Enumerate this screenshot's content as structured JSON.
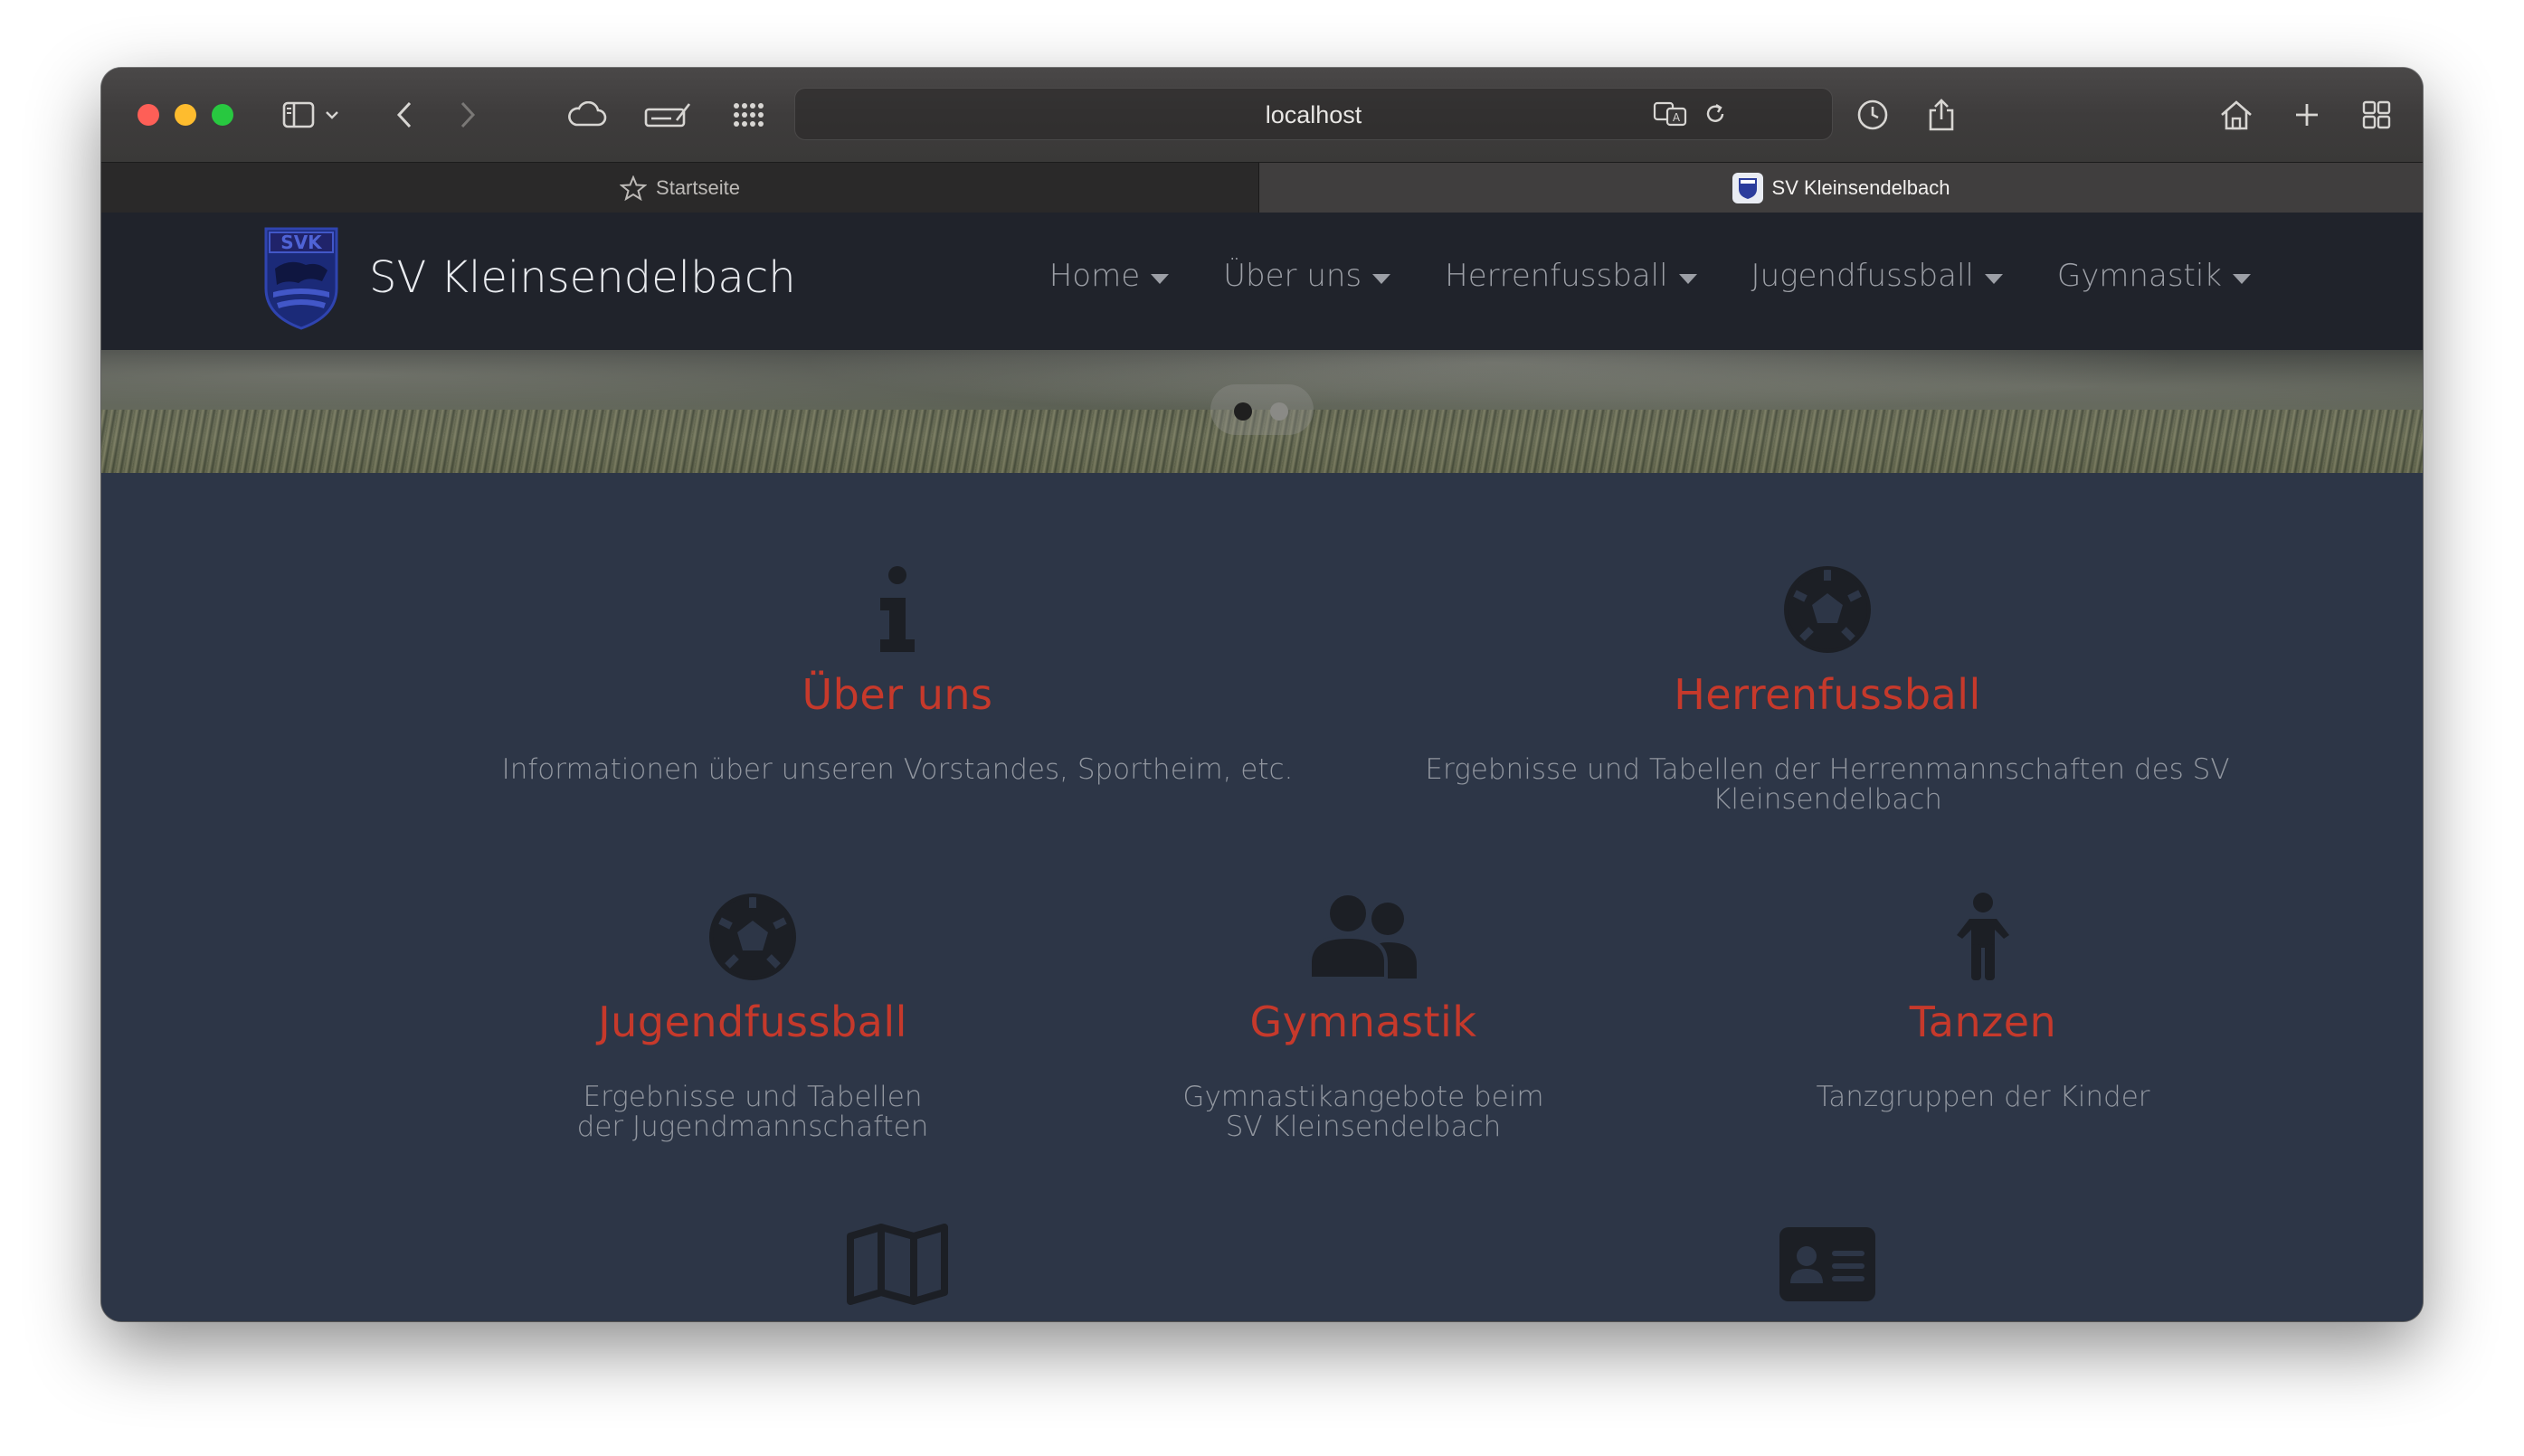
{
  "browser": {
    "url": "localhost",
    "tabs": [
      {
        "label": "Startseite",
        "active": false
      },
      {
        "label": "SV Kleinsendelbach",
        "active": true
      }
    ]
  },
  "site": {
    "brand": "SV Kleinsendelbach",
    "logo_text": "SVK",
    "nav": [
      {
        "label": "Home"
      },
      {
        "label": "Über uns"
      },
      {
        "label": "Herrenfussball"
      },
      {
        "label": "Jugendfussball"
      },
      {
        "label": "Gymnastik"
      }
    ]
  },
  "carousel": {
    "slides": 2,
    "active": 1
  },
  "features": [
    {
      "icon": "info-icon",
      "title": "Über uns",
      "text": "Informationen über unseren Vorstandes, Sportheim, etc."
    },
    {
      "icon": "soccer-ball-icon",
      "title": "Herrenfussball",
      "text": "Ergebnisse und Tabellen der Herrenmannschaften des SV Kleinsendelbach"
    },
    {
      "icon": "soccer-ball-icon",
      "title": "Jugendfussball",
      "text": "Ergebnisse und Tabellen der Jugendmannschaften"
    },
    {
      "icon": "users-icon",
      "title": "Gymnastik",
      "text": "Gymnastikangebote beim SV Kleinsendelbach"
    },
    {
      "icon": "child-icon",
      "title": "Tanzen",
      "text": "Tanzgruppen der Kinder"
    },
    {
      "icon": "map-icon",
      "title": "",
      "text": ""
    },
    {
      "icon": "id-card-icon",
      "title": "",
      "text": ""
    }
  ],
  "colors": {
    "accent": "#c6392b",
    "content_bg": "#2d3647",
    "nav_bg": "#20232b",
    "icon": "#1c1f25"
  }
}
